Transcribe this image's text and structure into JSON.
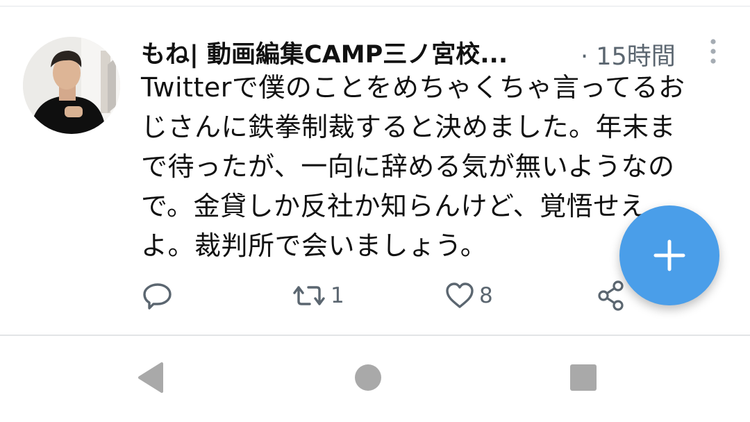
{
  "tweet": {
    "author_name": "もね| 動画編集CAMP三ノ宮校...",
    "timestamp": "· 15時間",
    "body_lines": [
      "Twitterで僕のことをめちゃくちゃ言ってるお",
      "じさんに鉄拳制裁すると決めました。年末ま",
      "で待ったが、一向に辞める気が無いようなの",
      "で。金貸しか反社か知らんけど、覚悟せえ",
      "よ。裁判所で会いましょう。"
    ],
    "actions": {
      "reply_icon": "reply-icon",
      "retweet_icon": "retweet-icon",
      "retweet_count": "1",
      "like_icon": "heart-icon",
      "like_count": "8",
      "share_icon": "share-icon"
    },
    "more_icon": "more-vertical-icon"
  },
  "fab": {
    "icon": "plus-icon"
  },
  "navbar": {
    "back_icon": "back-triangle-icon",
    "home_icon": "home-circle-icon",
    "recents_icon": "recents-square-icon"
  },
  "colors": {
    "text_primary": "#111111",
    "text_secondary": "#5b6670",
    "fab_blue": "#4a9ee9",
    "nav_gray": "#a9a9a9"
  }
}
